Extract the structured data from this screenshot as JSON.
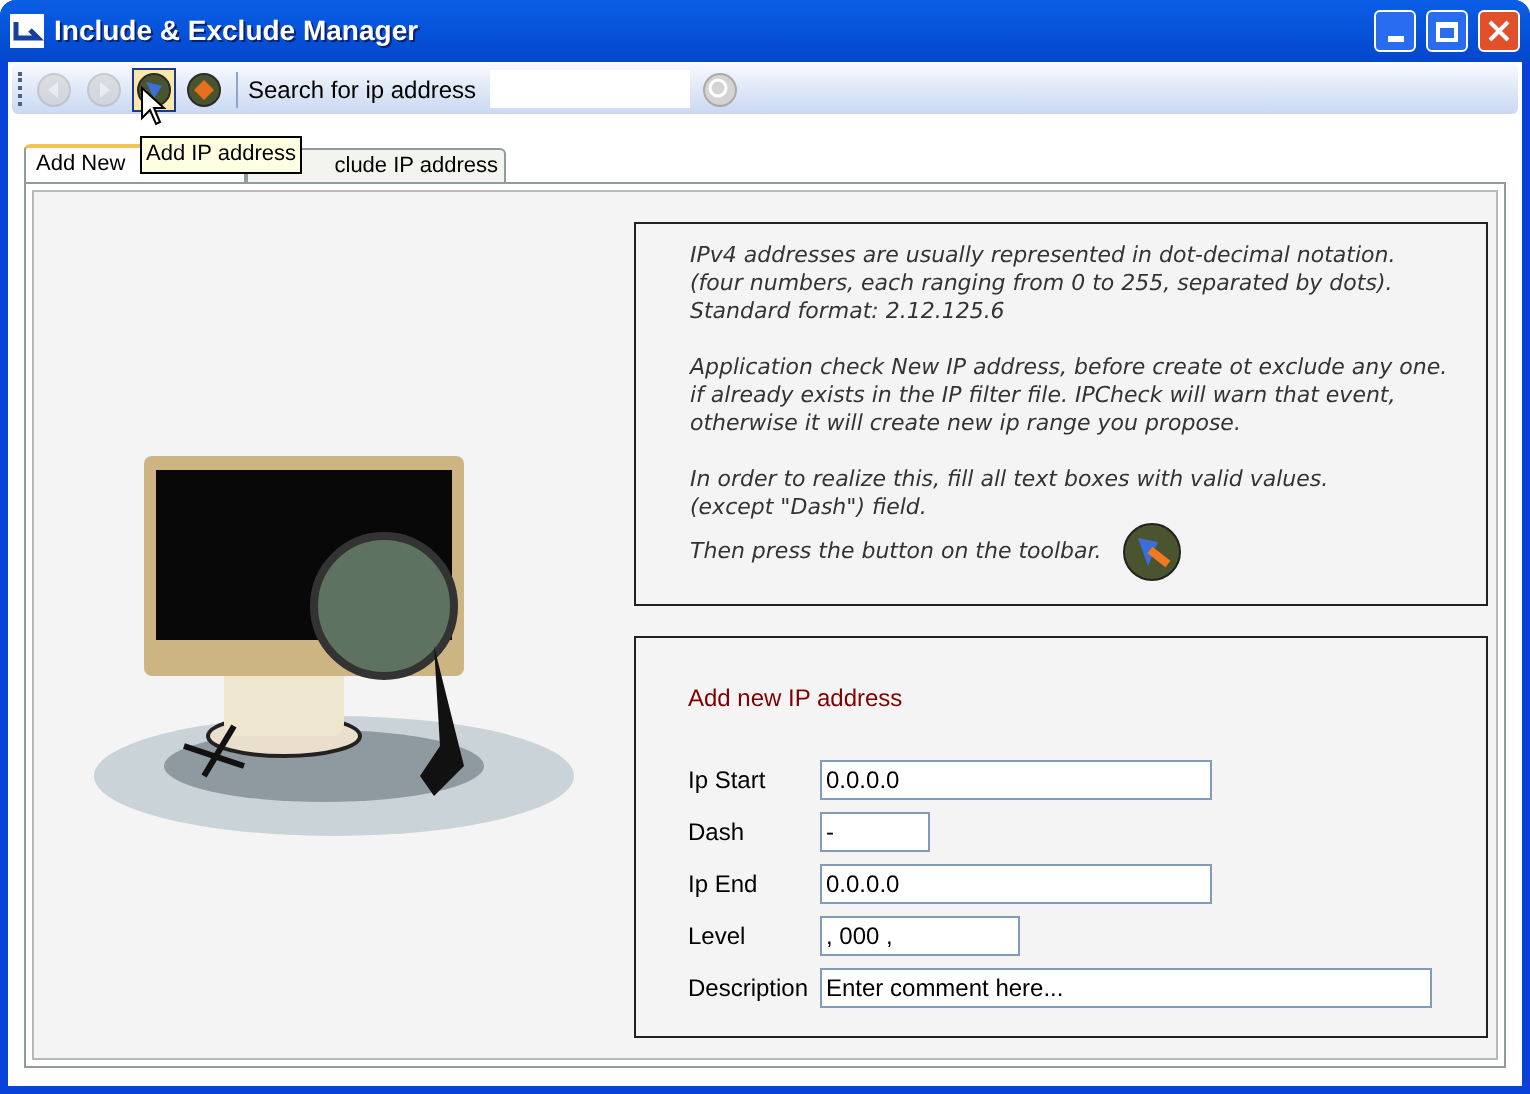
{
  "window": {
    "title": "Include & Exclude Manager"
  },
  "toolbar": {
    "buttons": [
      {
        "kind": "back",
        "disabled": true,
        "selected": false
      },
      {
        "kind": "forward",
        "disabled": true,
        "selected": false
      },
      {
        "kind": "add",
        "disabled": false,
        "selected": true
      },
      {
        "kind": "exclude",
        "disabled": false,
        "selected": false
      }
    ],
    "search_label": "Search for ip address",
    "search_button_disabled": true
  },
  "tooltip": "Add IP address",
  "tabs": [
    {
      "label": "Add New",
      "selected": true
    },
    {
      "label": "clude IP address",
      "selected": false
    }
  ],
  "info": [
    [
      "IPv4 addresses are usually represented in dot-decimal notation.",
      "(four numbers, each ranging from 0 to 255, separated by dots).",
      "Standard format: 2.12.125.6"
    ],
    [
      "Application check New IP address, before create ot exclude any one.",
      "if already exists in the IP filter file. IPCheck will warn that event,",
      "otherwise it will create new ip range you propose."
    ],
    [
      "In order to realize this, fill all text boxes with valid values.",
      "(except \"Dash\") field.",
      "Then press the button on the toolbar."
    ]
  ],
  "form": {
    "title": "Add new IP address",
    "fields": [
      {
        "label": "Ip Start",
        "value": "0.0.0.0",
        "kind": "ip"
      },
      {
        "label": "Dash",
        "value": "-",
        "kind": "short"
      },
      {
        "label": "Ip End",
        "value": "0.0.0.0",
        "kind": "ip"
      },
      {
        "label": "Level",
        "value": ", 000 ,",
        "kind": "medium"
      },
      {
        "label": "Description",
        "value": "Enter comment here...",
        "kind": "wide"
      }
    ]
  }
}
